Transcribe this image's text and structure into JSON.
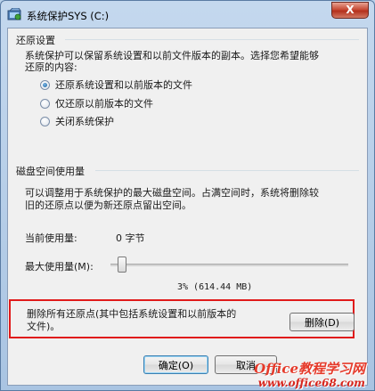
{
  "window": {
    "title": "系统保护SYS (C:)",
    "close_label": "X"
  },
  "restore_settings": {
    "heading": "还原设置",
    "description_line1": "系统保护可以保留系统设置和以前文件版本的副本。选择您希望能够",
    "description_line2": "还原的内容:",
    "options": [
      {
        "label": "还原系统设置和以前版本的文件",
        "checked": true
      },
      {
        "label": "仅还原以前版本的文件",
        "checked": false
      },
      {
        "label": "关闭系统保护",
        "checked": false
      }
    ]
  },
  "disk_usage": {
    "heading": "磁盘空间使用量",
    "description_line1": "可以调整用于系统保护的最大磁盘空间。占满空间时，系统将删除较",
    "description_line2": "旧的还原点以便为新还原点留出空间。",
    "current_label": "当前使用量:",
    "current_value": "0 字节",
    "max_label": "最大使用量(M):",
    "slider_percent": 3,
    "slider_readout": "3% (614.44 MB)"
  },
  "delete_section": {
    "text_line1": "删除所有还原点(其中包括系统设置和以前版本的",
    "text_line2": "文件)。",
    "button_label": "删除(D)",
    "highlight_color": "#e01b1b"
  },
  "footer": {
    "ok_label": "确定(O)",
    "cancel_label": "取消"
  },
  "watermark": {
    "brand": "Office教程学习网",
    "url": "www.office68.com"
  }
}
